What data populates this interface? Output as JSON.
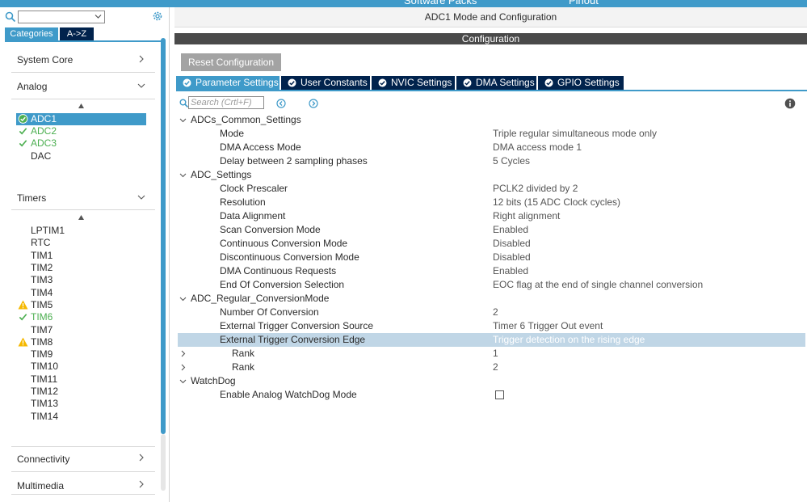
{
  "top_tabs": [
    "Software Packs",
    "Pinout"
  ],
  "left": {
    "tabs": {
      "categories": "Categories",
      "az": "A->Z"
    },
    "categories": {
      "system_core": "System Core",
      "analog": "Analog",
      "timers": "Timers",
      "connectivity": "Connectivity",
      "multimedia": "Multimedia"
    },
    "analog_items": [
      {
        "label": "ADC1",
        "status": "checked-selected"
      },
      {
        "label": "ADC2",
        "status": "ok"
      },
      {
        "label": "ADC3",
        "status": "ok"
      },
      {
        "label": "DAC",
        "status": "none"
      }
    ],
    "timer_items": [
      {
        "label": "LPTIM1",
        "status": "none"
      },
      {
        "label": "RTC",
        "status": "none"
      },
      {
        "label": "TIM1",
        "status": "none"
      },
      {
        "label": "TIM2",
        "status": "none"
      },
      {
        "label": "TIM3",
        "status": "none"
      },
      {
        "label": "TIM4",
        "status": "none"
      },
      {
        "label": "TIM5",
        "status": "warning"
      },
      {
        "label": "TIM6",
        "status": "ok"
      },
      {
        "label": "TIM7",
        "status": "none"
      },
      {
        "label": "TIM8",
        "status": "warning"
      },
      {
        "label": "TIM9",
        "status": "none"
      },
      {
        "label": "TIM10",
        "status": "none"
      },
      {
        "label": "TIM11",
        "status": "none"
      },
      {
        "label": "TIM12",
        "status": "none"
      },
      {
        "label": "TIM13",
        "status": "none"
      },
      {
        "label": "TIM14",
        "status": "none"
      }
    ]
  },
  "right": {
    "mode_title": "ADC1 Mode and Configuration",
    "config_title": "Configuration",
    "reset_label": "Reset Configuration",
    "tabs": [
      "Parameter Settings",
      "User Constants",
      "NVIC Settings",
      "DMA Settings",
      "GPIO Settings"
    ],
    "search_placeholder": "Search (Crtl+F)",
    "groups": {
      "common": "ADCs_Common_Settings",
      "settings": "ADC_Settings",
      "regular": "ADC_Regular_ConversionMode",
      "watchdog": "WatchDog"
    },
    "params": {
      "mode": {
        "k": "Mode",
        "v": "Triple regular simultaneous mode only"
      },
      "dma_access": {
        "k": "DMA Access Mode",
        "v": "DMA access mode 1"
      },
      "delay": {
        "k": "Delay between 2 sampling phases",
        "v": "5 Cycles"
      },
      "clock": {
        "k": "Clock Prescaler",
        "v": "PCLK2 divided by 2"
      },
      "resolution": {
        "k": "Resolution",
        "v": "12 bits (15 ADC Clock cycles)"
      },
      "alignment": {
        "k": "Data Alignment",
        "v": "Right alignment"
      },
      "scan": {
        "k": "Scan Conversion Mode",
        "v": "Enabled"
      },
      "continuous": {
        "k": "Continuous Conversion Mode",
        "v": "Disabled"
      },
      "discontinuous": {
        "k": "Discontinuous Conversion Mode",
        "v": "Disabled"
      },
      "dma_cont": {
        "k": "DMA Continuous Requests",
        "v": "Enabled"
      },
      "eoc": {
        "k": "End Of Conversion Selection",
        "v": "EOC flag at the end of single channel conversion"
      },
      "num_conv": {
        "k": "Number Of Conversion",
        "v": "2"
      },
      "ext_src": {
        "k": "External Trigger Conversion Source",
        "v": "Timer 6 Trigger Out event"
      },
      "ext_edge": {
        "k": "External Trigger Conversion Edge",
        "v": "Trigger detection on the rising edge"
      },
      "rank1": {
        "k": "Rank",
        "v": "1"
      },
      "rank2": {
        "k": "Rank",
        "v": "2"
      },
      "watchdog_en": {
        "k": "Enable Analog WatchDog Mode",
        "checked": false
      }
    }
  },
  "colors": {
    "accent": "#3f9ac9",
    "dark": "#01234d",
    "ok": "#4caf50",
    "warn": "#f5b800"
  }
}
